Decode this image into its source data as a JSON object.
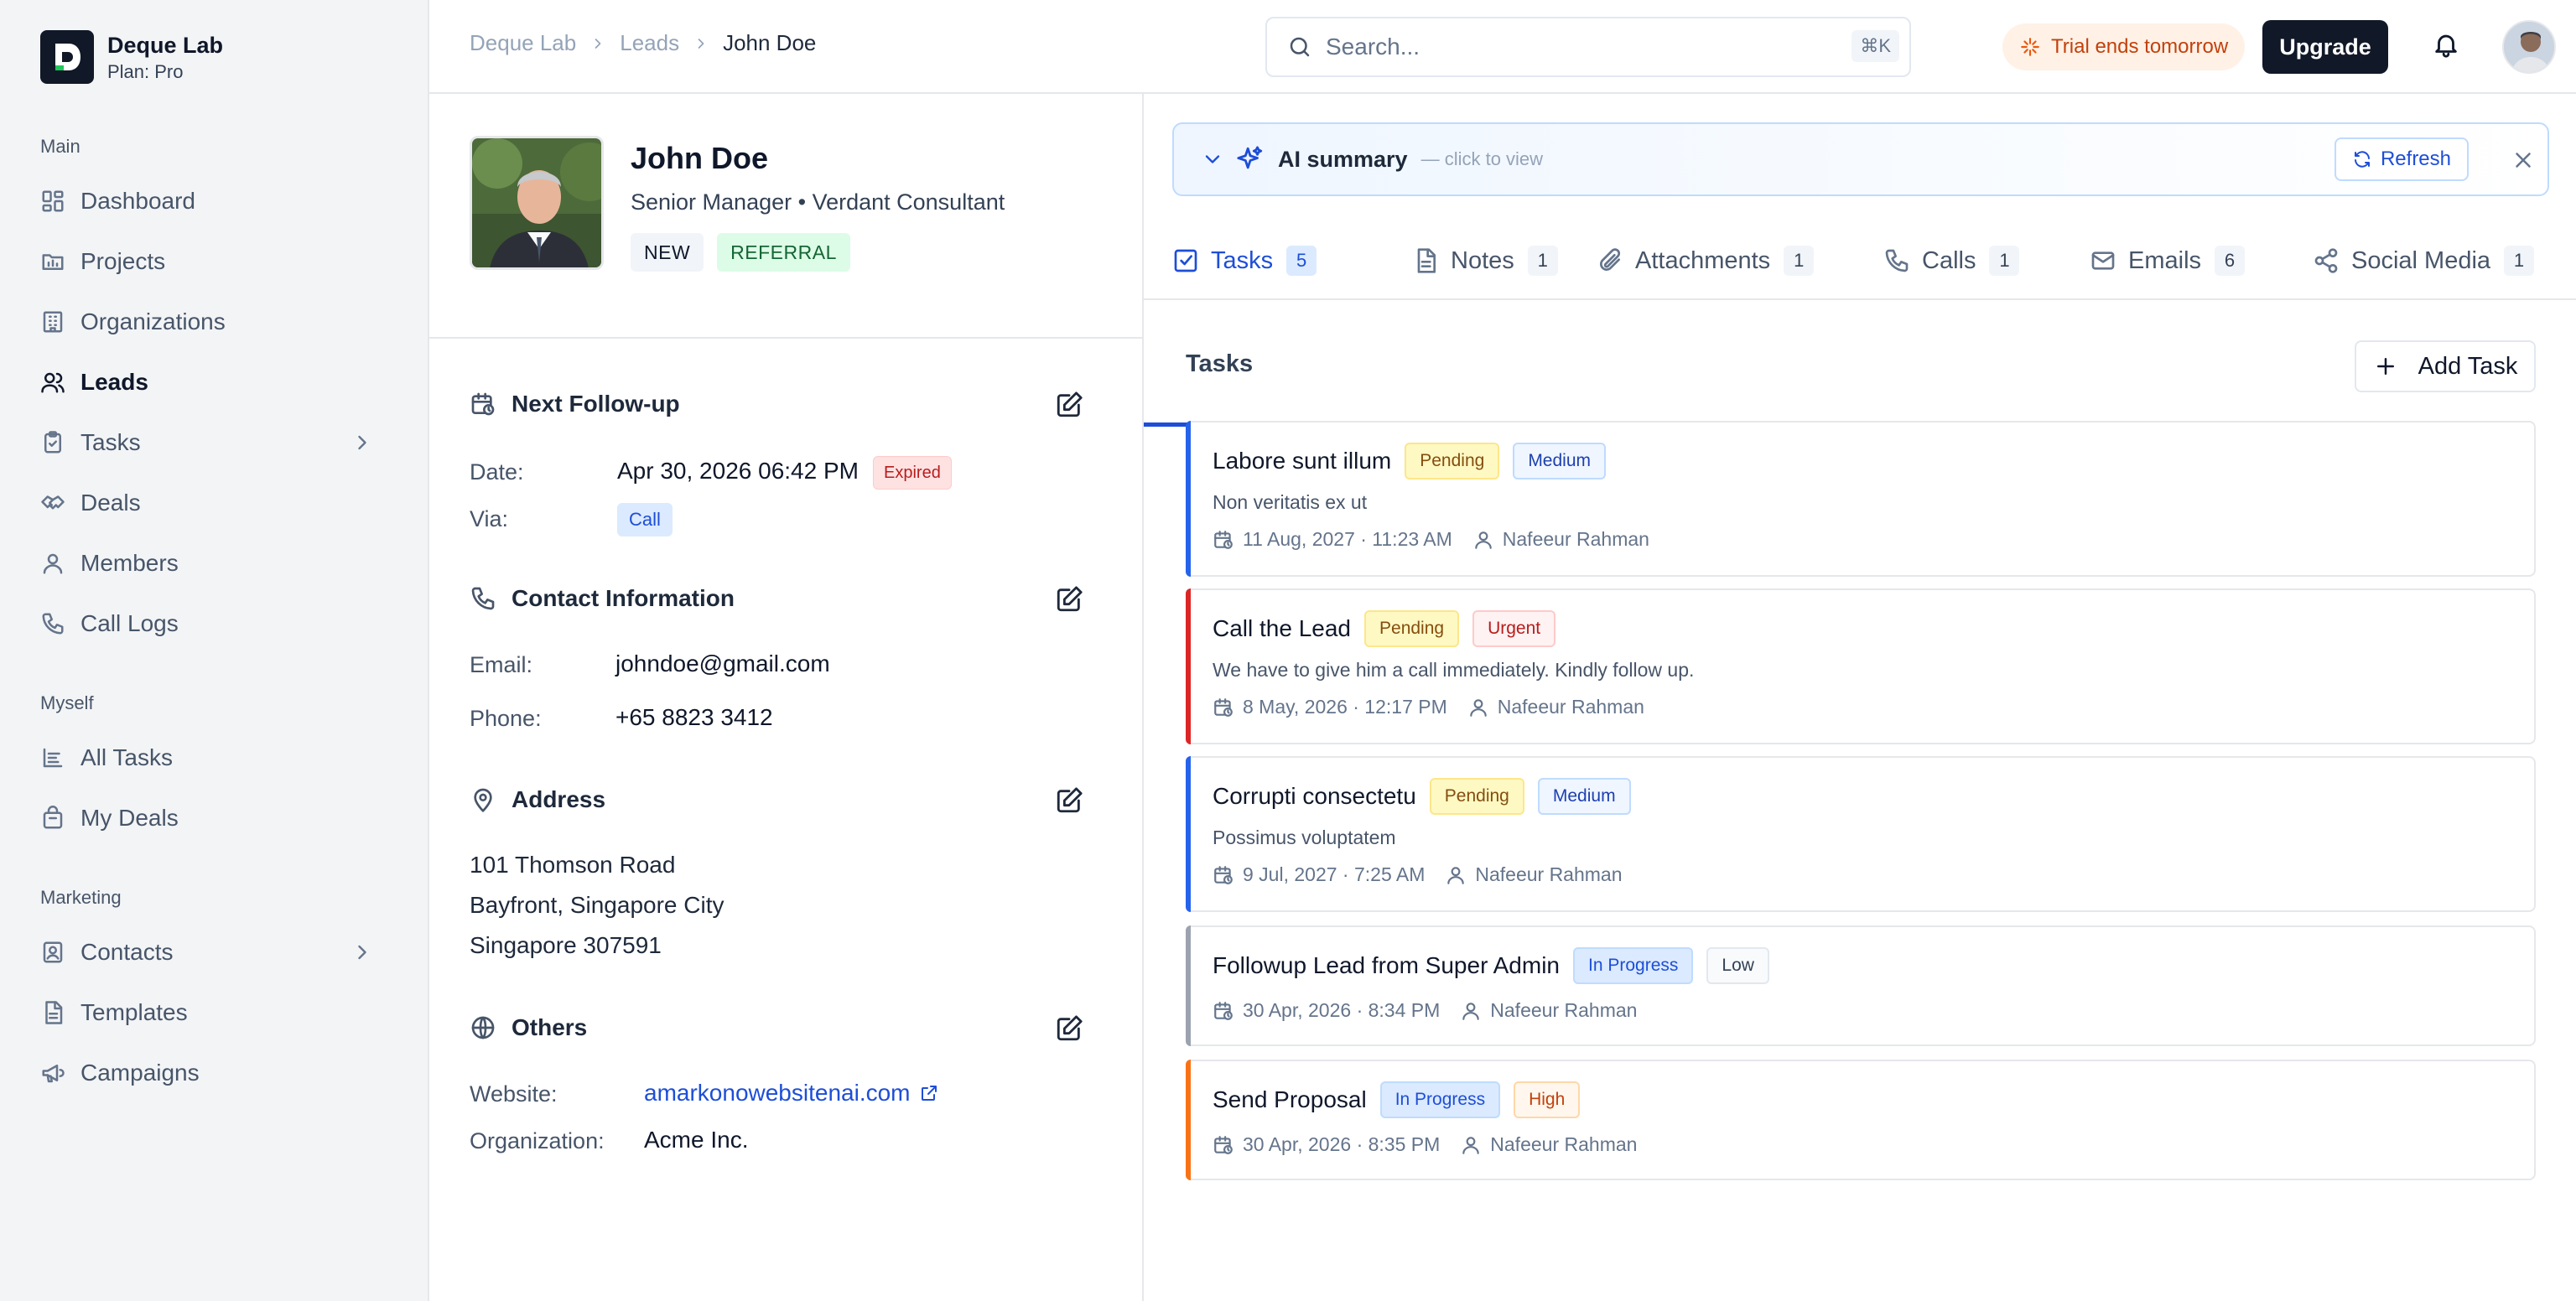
{
  "brand": {
    "name": "Deque Lab",
    "plan": "Plan: Pro"
  },
  "sidebar": {
    "main_label": "Main",
    "main_items": [
      {
        "label": "Dashboard",
        "icon": "dashboard-icon"
      },
      {
        "label": "Projects",
        "icon": "projects-icon"
      },
      {
        "label": "Organizations",
        "icon": "building-icon"
      },
      {
        "label": "Leads",
        "icon": "users-icon",
        "active": true
      },
      {
        "label": "Tasks",
        "icon": "clipboard-icon",
        "has_children": true
      },
      {
        "label": "Deals",
        "icon": "handshake-icon"
      },
      {
        "label": "Members",
        "icon": "user-icon"
      },
      {
        "label": "Call Logs",
        "icon": "phone-icon"
      }
    ],
    "myself_label": "Myself",
    "myself_items": [
      {
        "label": "All Tasks",
        "icon": "list-icon"
      },
      {
        "label": "My Deals",
        "icon": "bag-icon"
      }
    ],
    "marketing_label": "Marketing",
    "marketing_items": [
      {
        "label": "Contacts",
        "icon": "contact-icon",
        "has_children": true
      },
      {
        "label": "Templates",
        "icon": "file-icon"
      },
      {
        "label": "Campaigns",
        "icon": "megaphone-icon"
      }
    ]
  },
  "header": {
    "breadcrumbs": [
      "Deque Lab",
      "Leads",
      "John Doe"
    ],
    "search_placeholder": "Search...",
    "search_shortcut": "⌘K",
    "trial_text": "Trial ends tomorrow",
    "upgrade_label": "Upgrade"
  },
  "lead": {
    "name": "John Doe",
    "title": "Senior Manager • Verdant Consultant",
    "tags": [
      "NEW",
      "REFERRAL"
    ]
  },
  "follow_up": {
    "heading": "Next Follow-up",
    "date_label": "Date:",
    "date_value": "Apr 30, 2026 06:42 PM",
    "expired_badge": "Expired",
    "via_label": "Via:",
    "via_value": "Call"
  },
  "contact": {
    "heading": "Contact Information",
    "email_label": "Email:",
    "email_value": "johndoe@gmail.com",
    "phone_label": "Phone:",
    "phone_value": "+65 8823 3412"
  },
  "address": {
    "heading": "Address",
    "lines": [
      "101 Thomson Road",
      "Bayfront, Singapore City",
      "Singapore 307591"
    ]
  },
  "others": {
    "heading": "Others",
    "website_label": "Website:",
    "website_value": "amarkonowebsitenai.com",
    "org_label": "Organization:",
    "org_value": "Acme Inc."
  },
  "ai_summary": {
    "title": "AI summary",
    "hint": "— click to view",
    "refresh_label": "Refresh"
  },
  "tabs": [
    {
      "label": "Tasks",
      "count": "5",
      "icon": "checkbox-icon",
      "active": true
    },
    {
      "label": "Notes",
      "count": "1",
      "icon": "note-icon"
    },
    {
      "label": "Attachments",
      "count": "1",
      "icon": "paperclip-icon"
    },
    {
      "label": "Calls",
      "count": "1",
      "icon": "phone-icon"
    },
    {
      "label": "Emails",
      "count": "6",
      "icon": "mail-icon"
    },
    {
      "label": "Social Media",
      "count": "1",
      "icon": "share-icon"
    }
  ],
  "tasks_panel": {
    "heading": "Tasks",
    "add_label": "Add Task",
    "tasks": [
      {
        "title": "Labore sunt illum",
        "status": "Pending",
        "priority": "Medium",
        "description": "Non veritatis ex ut",
        "date": "11 Aug, 2027 · 11:23 AM",
        "assignee": "Nafeeur Rahman",
        "accent": "#2563eb"
      },
      {
        "title": "Call the Lead",
        "status": "Pending",
        "priority": "Urgent",
        "description": "We have to give him a call immediately. Kindly follow up.",
        "date": "8 May, 2026 · 12:17 PM",
        "assignee": "Nafeeur Rahman",
        "accent": "#dc2626"
      },
      {
        "title": "Corrupti consectetu",
        "status": "Pending",
        "priority": "Medium",
        "description": "Possimus voluptatem",
        "date": "9 Jul, 2027 · 7:25 AM",
        "assignee": "Nafeeur Rahman",
        "accent": "#2563eb"
      },
      {
        "title": "Followup Lead from Super Admin",
        "status": "In Progress",
        "priority": "Low",
        "description": "",
        "date": "30 Apr, 2026 · 8:34 PM",
        "assignee": "Nafeeur Rahman",
        "accent": "#9ca3af"
      },
      {
        "title": "Send Proposal",
        "status": "In Progress",
        "priority": "High",
        "description": "",
        "date": "30 Apr, 2026 · 8:35 PM",
        "assignee": "Nafeeur Rahman",
        "accent": "#f97316"
      }
    ]
  }
}
